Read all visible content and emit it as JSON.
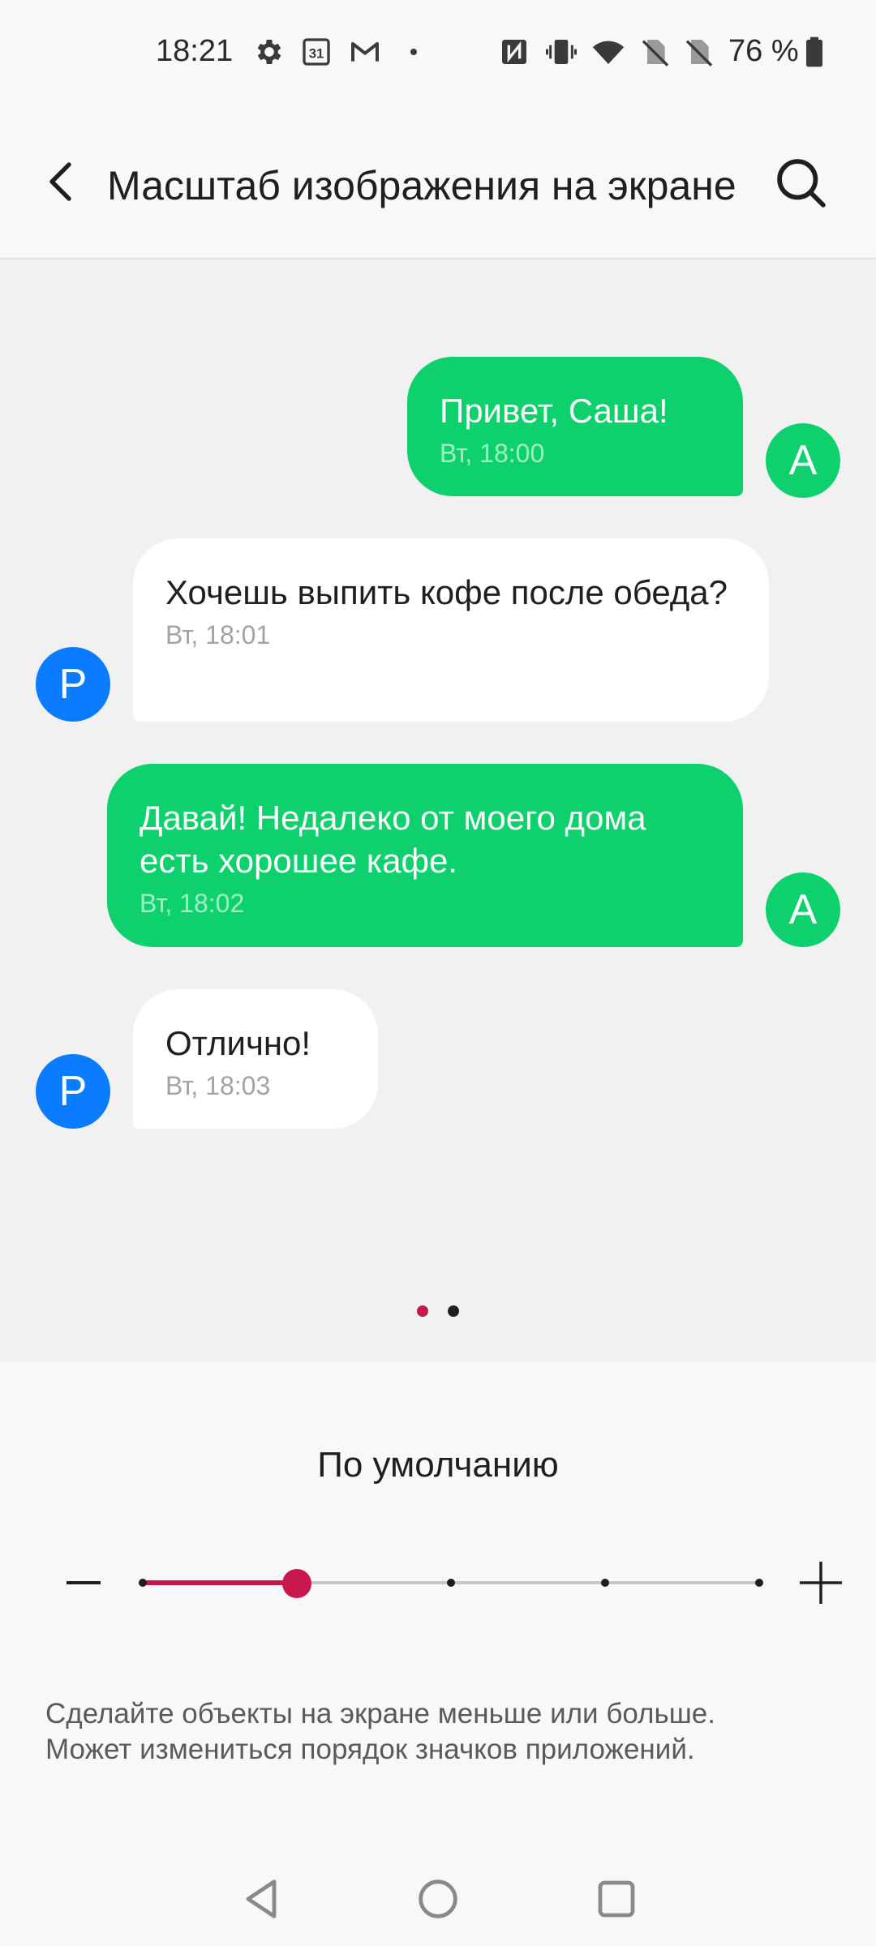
{
  "status_bar": {
    "time": "18:21",
    "calendar_day": "31",
    "battery_text": "76 %",
    "icons": [
      "gear-icon",
      "calendar-icon",
      "gmail-icon",
      "dot-icon",
      "nfc-icon",
      "vibrate-icon",
      "wifi-icon",
      "no-sim-icon",
      "no-sim-icon",
      "battery-icon"
    ]
  },
  "app_bar": {
    "title": "Масштаб изображения на экране",
    "back_icon": "back-arrow-icon",
    "search_icon": "search-icon"
  },
  "preview": {
    "messages": [
      {
        "direction": "out",
        "text": "Привет, Саша!",
        "time": "Вт, 18:00",
        "avatar": "A"
      },
      {
        "direction": "in",
        "text": "Хочешь выпить кофе после обеда?",
        "time": "Вт, 18:01",
        "avatar": "P"
      },
      {
        "direction": "out",
        "text": "Давай! Недалеко от моего дома есть хорошее кафе.",
        "time": "Вт, 18:02",
        "avatar": "A"
      },
      {
        "direction": "in",
        "text": "Отлично!",
        "time": "Вт, 18:03",
        "avatar": "P"
      }
    ],
    "page_indicator": {
      "count": 2,
      "active": 0
    }
  },
  "size_setting": {
    "label": "По умолчанию",
    "steps": 5,
    "selected_index": 1,
    "minus_icon": "minus-icon",
    "plus_icon": "plus-icon"
  },
  "description": {
    "line1": "Сделайте объекты на экране меньше или больше.",
    "line2": "Может измениться порядок значков приложений."
  },
  "colors": {
    "outgoing_bubble": "#0ed16d",
    "incoming_bubble": "#ffffff",
    "avatar_out": "#0ed16d",
    "avatar_in": "#0b7cff",
    "accent": "#c8174a",
    "preview_background": "#f1f1f1"
  },
  "nav_bar": [
    "nav-back-icon",
    "nav-home-icon",
    "nav-recents-icon"
  ]
}
